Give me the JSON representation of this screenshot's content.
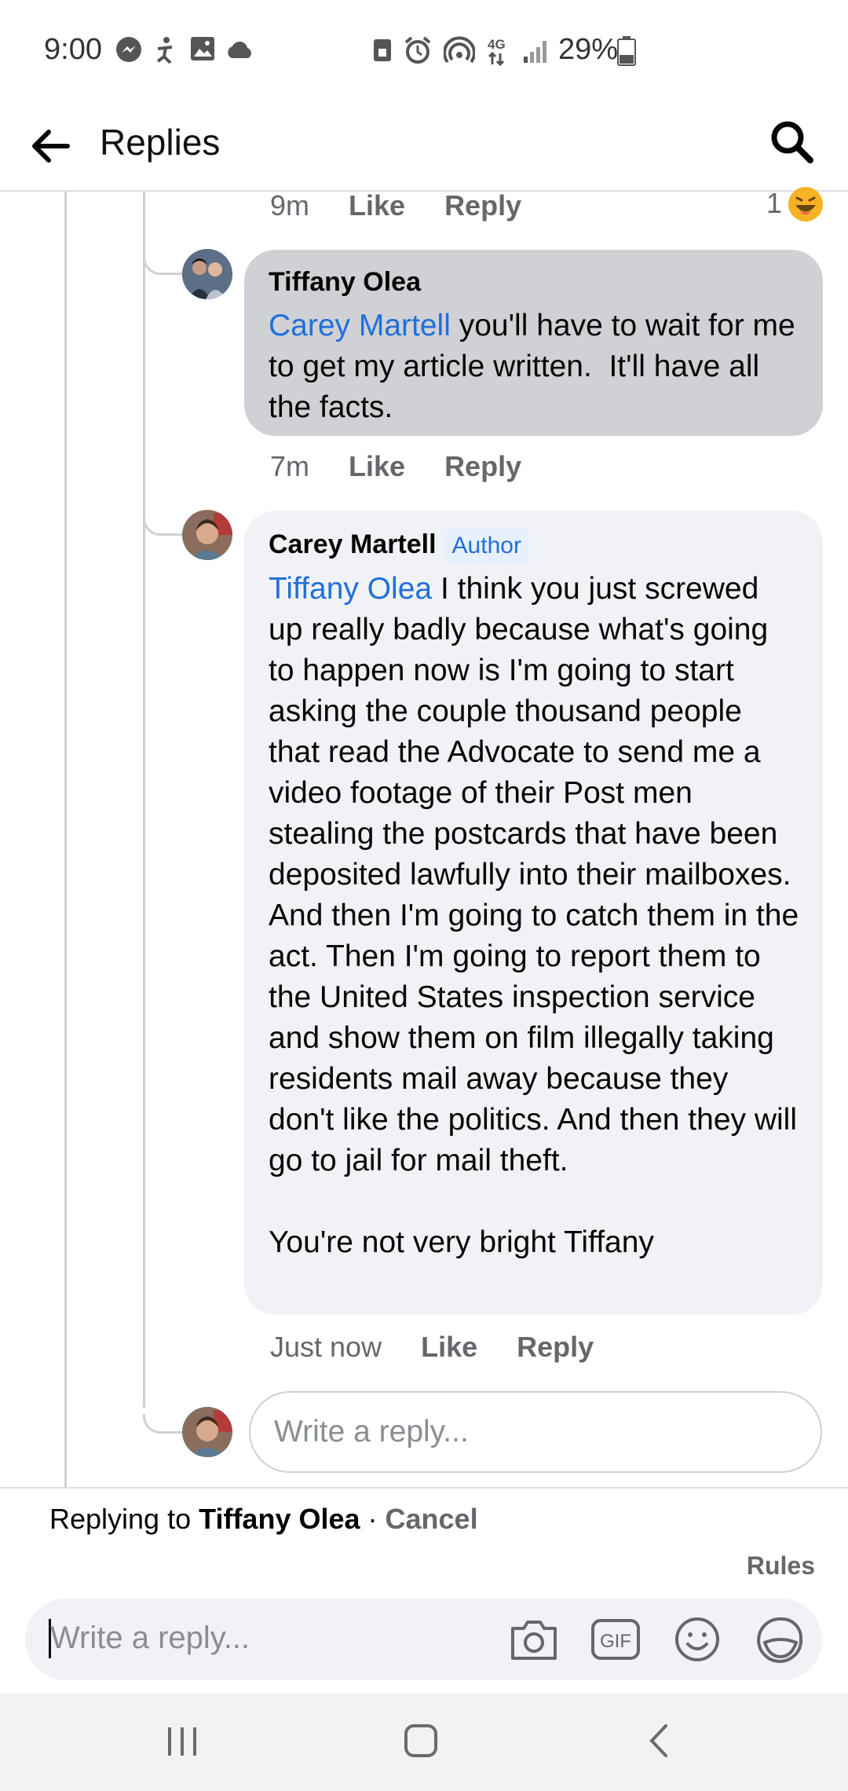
{
  "status": {
    "time": "9:00",
    "battery": "29%",
    "network": "4G"
  },
  "header": {
    "title": "Replies"
  },
  "thread": {
    "top_meta": {
      "time": "9m",
      "like": "Like",
      "reply": "Reply",
      "reaction_count": "1"
    },
    "comments": [
      {
        "author": "Tiffany Olea",
        "mention": "Carey Martell",
        "text": " you'll have to wait for me to get my article written.  It'll have all the facts.",
        "time": "7m",
        "like": "Like",
        "reply": "Reply"
      },
      {
        "author": "Carey Martell",
        "badge": "Author",
        "mention": "Tiffany Olea",
        "text": " I think you just screwed up really badly because what's going to happen now is I'm going to start asking the couple thousand people that read the Advocate to send me a video footage of their Post men stealing the postcards that have been deposited lawfully into their mailboxes.  And then I'm going to catch them in the act. Then I'm going to report them to the United States inspection service and show them on film illegally taking residents mail away because they don't like the politics. And then they will go to jail for mail theft.\n\nYou're not very bright Tiffany",
        "time": "Just now",
        "like": "Like",
        "reply": "Reply"
      }
    ],
    "inline_reply_placeholder": "Write a reply..."
  },
  "compose": {
    "replying_prefix": "Replying to ",
    "replying_name": "Tiffany Olea",
    "separator": " · ",
    "cancel": "Cancel",
    "rules": "Rules",
    "placeholder": "Write a reply..."
  },
  "icons": [
    "back-arrow-icon",
    "search-icon",
    "camera-icon",
    "gif-icon",
    "emoji-icon",
    "sticker-icon",
    "recent-apps-icon",
    "home-icon",
    "back-nav-icon"
  ]
}
